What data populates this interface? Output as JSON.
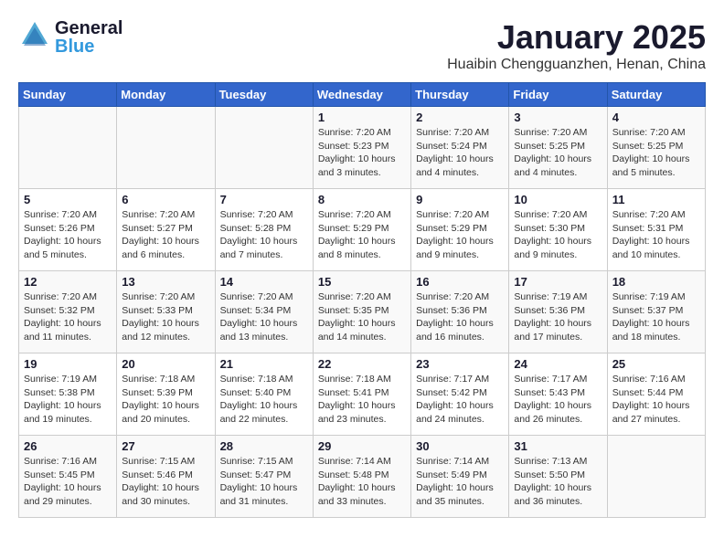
{
  "header": {
    "logo_line1": "General",
    "logo_line2": "Blue",
    "title": "January 2025",
    "subtitle": "Huaibin Chengguanzhen, Henan, China"
  },
  "calendar": {
    "days_of_week": [
      "Sunday",
      "Monday",
      "Tuesday",
      "Wednesday",
      "Thursday",
      "Friday",
      "Saturday"
    ],
    "weeks": [
      [
        {
          "day": "",
          "info": ""
        },
        {
          "day": "",
          "info": ""
        },
        {
          "day": "",
          "info": ""
        },
        {
          "day": "1",
          "info": "Sunrise: 7:20 AM\nSunset: 5:23 PM\nDaylight: 10 hours\nand 3 minutes."
        },
        {
          "day": "2",
          "info": "Sunrise: 7:20 AM\nSunset: 5:24 PM\nDaylight: 10 hours\nand 4 minutes."
        },
        {
          "day": "3",
          "info": "Sunrise: 7:20 AM\nSunset: 5:25 PM\nDaylight: 10 hours\nand 4 minutes."
        },
        {
          "day": "4",
          "info": "Sunrise: 7:20 AM\nSunset: 5:25 PM\nDaylight: 10 hours\nand 5 minutes."
        }
      ],
      [
        {
          "day": "5",
          "info": "Sunrise: 7:20 AM\nSunset: 5:26 PM\nDaylight: 10 hours\nand 5 minutes."
        },
        {
          "day": "6",
          "info": "Sunrise: 7:20 AM\nSunset: 5:27 PM\nDaylight: 10 hours\nand 6 minutes."
        },
        {
          "day": "7",
          "info": "Sunrise: 7:20 AM\nSunset: 5:28 PM\nDaylight: 10 hours\nand 7 minutes."
        },
        {
          "day": "8",
          "info": "Sunrise: 7:20 AM\nSunset: 5:29 PM\nDaylight: 10 hours\nand 8 minutes."
        },
        {
          "day": "9",
          "info": "Sunrise: 7:20 AM\nSunset: 5:29 PM\nDaylight: 10 hours\nand 9 minutes."
        },
        {
          "day": "10",
          "info": "Sunrise: 7:20 AM\nSunset: 5:30 PM\nDaylight: 10 hours\nand 9 minutes."
        },
        {
          "day": "11",
          "info": "Sunrise: 7:20 AM\nSunset: 5:31 PM\nDaylight: 10 hours\nand 10 minutes."
        }
      ],
      [
        {
          "day": "12",
          "info": "Sunrise: 7:20 AM\nSunset: 5:32 PM\nDaylight: 10 hours\nand 11 minutes."
        },
        {
          "day": "13",
          "info": "Sunrise: 7:20 AM\nSunset: 5:33 PM\nDaylight: 10 hours\nand 12 minutes."
        },
        {
          "day": "14",
          "info": "Sunrise: 7:20 AM\nSunset: 5:34 PM\nDaylight: 10 hours\nand 13 minutes."
        },
        {
          "day": "15",
          "info": "Sunrise: 7:20 AM\nSunset: 5:35 PM\nDaylight: 10 hours\nand 14 minutes."
        },
        {
          "day": "16",
          "info": "Sunrise: 7:20 AM\nSunset: 5:36 PM\nDaylight: 10 hours\nand 16 minutes."
        },
        {
          "day": "17",
          "info": "Sunrise: 7:19 AM\nSunset: 5:36 PM\nDaylight: 10 hours\nand 17 minutes."
        },
        {
          "day": "18",
          "info": "Sunrise: 7:19 AM\nSunset: 5:37 PM\nDaylight: 10 hours\nand 18 minutes."
        }
      ],
      [
        {
          "day": "19",
          "info": "Sunrise: 7:19 AM\nSunset: 5:38 PM\nDaylight: 10 hours\nand 19 minutes."
        },
        {
          "day": "20",
          "info": "Sunrise: 7:18 AM\nSunset: 5:39 PM\nDaylight: 10 hours\nand 20 minutes."
        },
        {
          "day": "21",
          "info": "Sunrise: 7:18 AM\nSunset: 5:40 PM\nDaylight: 10 hours\nand 22 minutes."
        },
        {
          "day": "22",
          "info": "Sunrise: 7:18 AM\nSunset: 5:41 PM\nDaylight: 10 hours\nand 23 minutes."
        },
        {
          "day": "23",
          "info": "Sunrise: 7:17 AM\nSunset: 5:42 PM\nDaylight: 10 hours\nand 24 minutes."
        },
        {
          "day": "24",
          "info": "Sunrise: 7:17 AM\nSunset: 5:43 PM\nDaylight: 10 hours\nand 26 minutes."
        },
        {
          "day": "25",
          "info": "Sunrise: 7:16 AM\nSunset: 5:44 PM\nDaylight: 10 hours\nand 27 minutes."
        }
      ],
      [
        {
          "day": "26",
          "info": "Sunrise: 7:16 AM\nSunset: 5:45 PM\nDaylight: 10 hours\nand 29 minutes."
        },
        {
          "day": "27",
          "info": "Sunrise: 7:15 AM\nSunset: 5:46 PM\nDaylight: 10 hours\nand 30 minutes."
        },
        {
          "day": "28",
          "info": "Sunrise: 7:15 AM\nSunset: 5:47 PM\nDaylight: 10 hours\nand 31 minutes."
        },
        {
          "day": "29",
          "info": "Sunrise: 7:14 AM\nSunset: 5:48 PM\nDaylight: 10 hours\nand 33 minutes."
        },
        {
          "day": "30",
          "info": "Sunrise: 7:14 AM\nSunset: 5:49 PM\nDaylight: 10 hours\nand 35 minutes."
        },
        {
          "day": "31",
          "info": "Sunrise: 7:13 AM\nSunset: 5:50 PM\nDaylight: 10 hours\nand 36 minutes."
        },
        {
          "day": "",
          "info": ""
        }
      ]
    ]
  }
}
